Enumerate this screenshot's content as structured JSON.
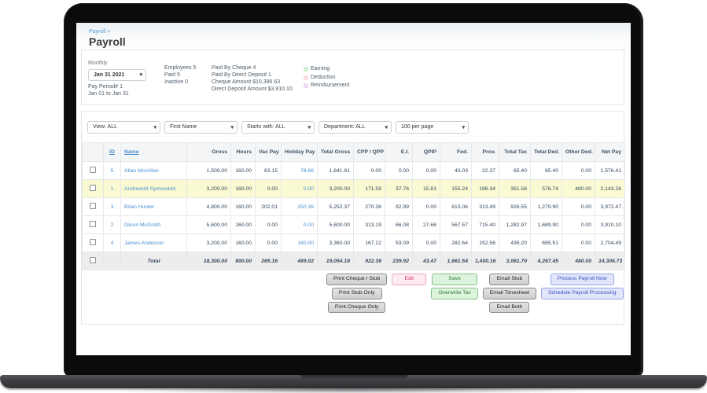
{
  "breadcrumb": {
    "trail": "Payroll >",
    "title": "Payroll"
  },
  "summary": {
    "period_label": "Monthly",
    "period_value": "Jan 31 2021",
    "pay_period": "Pay Period# 1",
    "date_range": "Jan 01 to Jan 31",
    "employees": "Employees 5",
    "paid": "Paid 5",
    "inactive": "Inactive 0",
    "paid_by_cheque": "Paid By Cheque 4",
    "paid_by_direct_deposit": "Paid By Direct Deposit 1",
    "cheque_amount": "Cheque Amount $10,396.63",
    "direct_deposit_amount": "Direct Deposit Amount $3,910.10",
    "legend": [
      {
        "label": "Earning",
        "color": "#d2f2d2"
      },
      {
        "label": "Deduction",
        "color": "#fbdde0"
      },
      {
        "label": "Reimbursement",
        "color": "#eddcf6"
      }
    ]
  },
  "filters": [
    {
      "value": "View: ALL"
    },
    {
      "value": "First Name"
    },
    {
      "value": "Starts with: ALL"
    },
    {
      "value": "Department: ALL"
    },
    {
      "value": "100 per page"
    }
  ],
  "table": {
    "columns": [
      "ID",
      "Name",
      "Gross",
      "Hours",
      "Vac Pay",
      "Holiday Pay",
      "Total Gross",
      "CPP / QPP",
      "E.I.",
      "QPIP",
      "Fed.",
      "Prov.",
      "Total Tax",
      "Total Ded.",
      "Other Ded.",
      "Net Pay"
    ],
    "rows": [
      {
        "id": "5",
        "name": "Allan Mcmillan",
        "highlight": false,
        "values": [
          "1,500.00",
          "160.00",
          "63.15",
          "78.66",
          "1,641.81",
          "0.00",
          "0.00",
          "0.00",
          "43.03",
          "22.37",
          "65.40",
          "65.40",
          "0.00",
          "1,576.41"
        ]
      },
      {
        "id": "1",
        "name": "Andrewdd Symonddd",
        "highlight": true,
        "values": [
          "3,200.00",
          "160.00",
          "0.00",
          "0.00",
          "3,200.00",
          "171.59",
          "37.76",
          "15.81",
          "155.24",
          "196.34",
          "351.58",
          "576.74",
          "480.00",
          "2,143.26"
        ]
      },
      {
        "id": "3",
        "name": "Brian Hunter",
        "highlight": false,
        "values": [
          "4,800.00",
          "160.00",
          "202.01",
          "250.36",
          "5,252.37",
          "270.36",
          "82.99",
          "0.00",
          "613.06",
          "313.49",
          "926.55",
          "1,279.90",
          "0.00",
          "3,972.47"
        ]
      },
      {
        "id": "2",
        "name": "Glenn McGrath",
        "highlight": false,
        "values": [
          "5,600.00",
          "160.00",
          "0.00",
          "0.00",
          "5,600.00",
          "313.19",
          "66.08",
          "27.66",
          "567.57",
          "715.40",
          "1,282.97",
          "1,689.90",
          "0.00",
          "3,910.10"
        ]
      },
      {
        "id": "4",
        "name": "James Anderson",
        "highlight": false,
        "values": [
          "3,200.00",
          "160.00",
          "0.00",
          "160.00",
          "3,360.00",
          "167.22",
          "53.09",
          "0.00",
          "282.64",
          "152.56",
          "435.20",
          "655.51",
          "0.00",
          "2,704.49"
        ]
      }
    ],
    "total": {
      "label": "Total",
      "values": [
        "18,300.00",
        "800.00",
        "265.16",
        "489.02",
        "19,054.18",
        "922.36",
        "239.92",
        "43.47",
        "1,661.54",
        "1,400.16",
        "3,061.70",
        "4,267.45",
        "480.00",
        "14,306.73"
      ]
    }
  },
  "actions": {
    "groups": [
      {
        "style": "gray",
        "buttons": [
          "Print Cheque / Stub",
          "Print Stub Only",
          "Print Cheque Only"
        ]
      },
      {
        "style": "pink",
        "buttons": [
          "Edit"
        ]
      },
      {
        "style": "green",
        "buttons": [
          "Save",
          "Overwrite Tax"
        ]
      },
      {
        "style": "gray",
        "buttons": [
          "Email Stub",
          "Email Timesheet",
          "Email Both"
        ]
      },
      {
        "style": "blue",
        "buttons": [
          "Process Payroll Now",
          "Schedule Payroll Processing"
        ]
      }
    ]
  },
  "colors": {
    "link_blue": "#4a90d2",
    "row_highlight": "#fafad2",
    "button_pink_text": "#d6336c",
    "button_green_text": "#2c7a2c",
    "button_blue_text": "#3b4fc4"
  }
}
